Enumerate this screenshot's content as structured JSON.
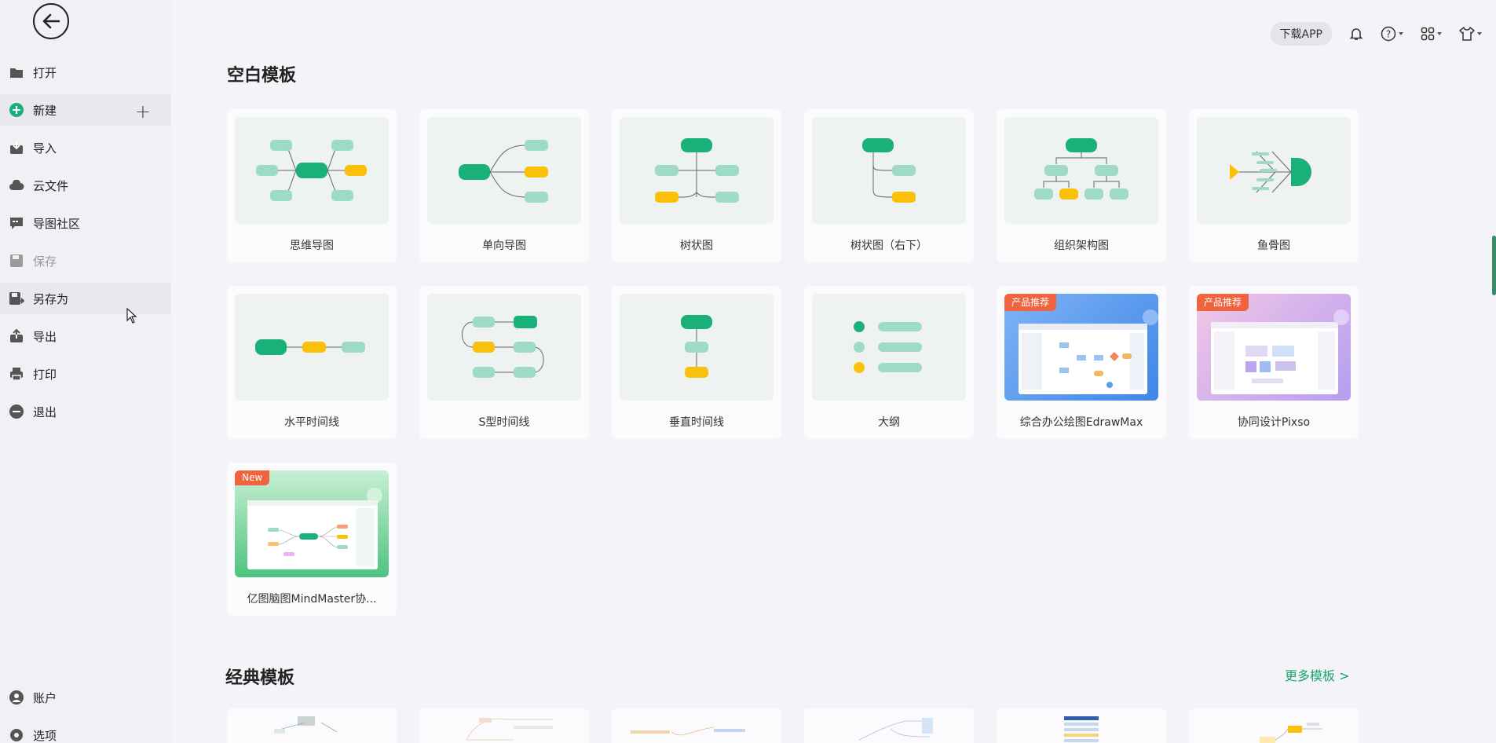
{
  "sidebar": {
    "items": [
      {
        "label": "打开"
      },
      {
        "label": "新建"
      },
      {
        "label": "导入"
      },
      {
        "label": "云文件"
      },
      {
        "label": "导图社区"
      },
      {
        "label": "保存"
      },
      {
        "label": "另存为"
      },
      {
        "label": "导出"
      },
      {
        "label": "打印"
      },
      {
        "label": "退出"
      }
    ],
    "bottom_items": [
      {
        "label": "账户"
      },
      {
        "label": "选项"
      }
    ]
  },
  "topbar": {
    "download_label": "下载APP"
  },
  "blank_section": {
    "title": "空白模板",
    "cards": [
      {
        "label": "思维导图"
      },
      {
        "label": "单向导图"
      },
      {
        "label": "树状图"
      },
      {
        "label": "树状图（右下）"
      },
      {
        "label": "组织架构图"
      },
      {
        "label": "鱼骨图"
      },
      {
        "label": "水平时间线"
      },
      {
        "label": "S型时间线"
      },
      {
        "label": "垂直时间线"
      },
      {
        "label": "大纲"
      },
      {
        "label": "综合办公绘图EdrawMax",
        "badge": "产品推荐"
      },
      {
        "label": "协同设计Pixso",
        "badge": "产品推荐"
      },
      {
        "label": "亿图脑图MindMaster协...",
        "badge": "New"
      }
    ]
  },
  "classic_section": {
    "title": "经典模板",
    "more_label": "更多模板 >"
  },
  "colors": {
    "green": "#19b07a",
    "light_green": "#9edbc6",
    "yellow": "#fbc10a",
    "badge": "#f0633f",
    "link": "#1aa36a"
  }
}
